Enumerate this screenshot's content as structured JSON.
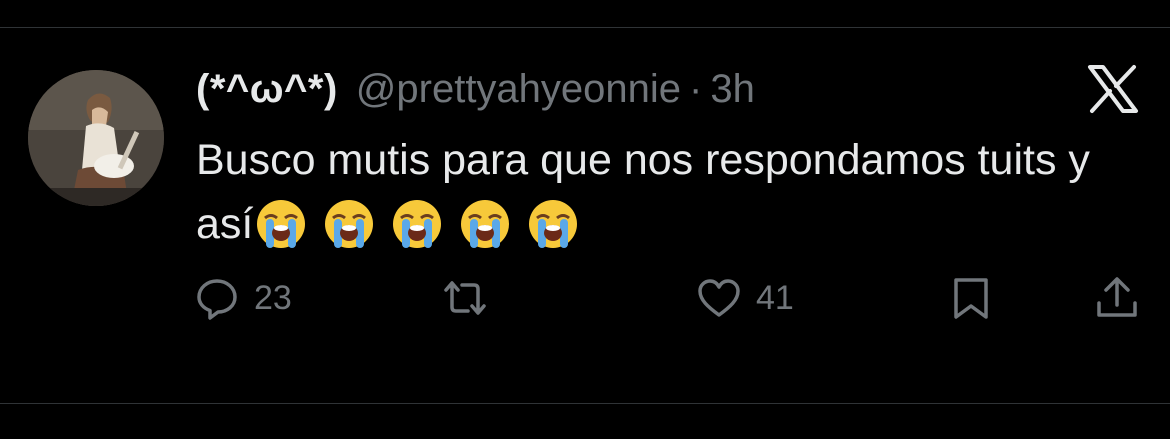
{
  "author": {
    "display_name": "(*^ω^*)",
    "handle": "@prettyahyeonnie",
    "separator": "·",
    "time": "3h"
  },
  "tweet": {
    "text": "Busco mutis para que nos respondamos tuits y así",
    "emoji": [
      "loudly-crying-face",
      "loudly-crying-face",
      "loudly-crying-face",
      "loudly-crying-face",
      "loudly-crying-face"
    ]
  },
  "actions": {
    "reply_count": "23",
    "retweet_count": "",
    "like_count": "41"
  },
  "colors": {
    "background": "#000000",
    "text_primary": "#e7e9ea",
    "text_secondary": "#71767b",
    "divider": "#2f3336"
  }
}
